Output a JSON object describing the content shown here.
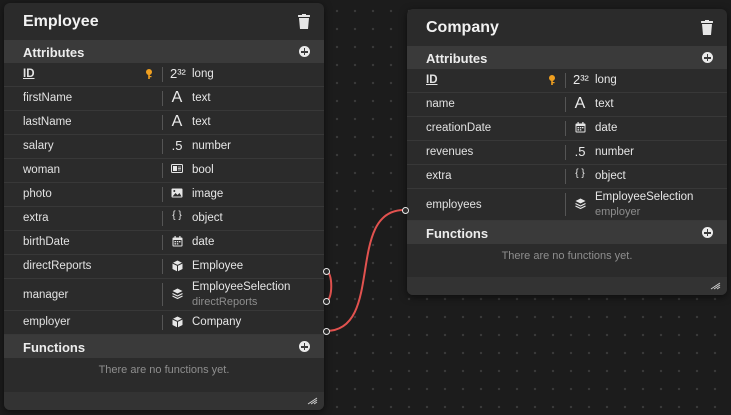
{
  "employee": {
    "title": "Employee",
    "attributes_label": "Attributes",
    "functions_label": "Functions",
    "empty_functions": "There are no functions yet.",
    "attributes": [
      {
        "name": "ID",
        "type_icon": "2³²",
        "type": "long",
        "pk": true
      },
      {
        "name": "firstName",
        "type_icon": "A",
        "type": "text"
      },
      {
        "name": "lastName",
        "type_icon": "A",
        "type": "text"
      },
      {
        "name": "salary",
        "type_icon": ".5",
        "type": "number"
      },
      {
        "name": "woman",
        "type_icon": "bool-icon",
        "type": "bool"
      },
      {
        "name": "photo",
        "type_icon": "image-icon",
        "type": "image"
      },
      {
        "name": "extra",
        "type_icon": "{ }",
        "type": "object"
      },
      {
        "name": "birthDate",
        "type_icon": "calendar-icon",
        "type": "date"
      },
      {
        "name": "directReports",
        "type_icon": "cube-icon",
        "type": "Employee"
      },
      {
        "name": "manager",
        "type_icon": "layers-icon",
        "type": "EmployeeSelection",
        "sub": "directReports"
      },
      {
        "name": "employer",
        "type_icon": "cube-icon",
        "type": "Company"
      }
    ]
  },
  "company": {
    "title": "Company",
    "attributes_label": "Attributes",
    "functions_label": "Functions",
    "empty_functions": "There are no functions yet.",
    "attributes": [
      {
        "name": "ID",
        "type_icon": "2³²",
        "type": "long",
        "pk": true
      },
      {
        "name": "name",
        "type_icon": "A",
        "type": "text"
      },
      {
        "name": "creationDate",
        "type_icon": "calendar-icon",
        "type": "date"
      },
      {
        "name": "revenues",
        "type_icon": ".5",
        "type": "number"
      },
      {
        "name": "extra",
        "type_icon": "{ }",
        "type": "object"
      },
      {
        "name": "employees",
        "type_icon": "layers-icon",
        "type": "EmployeeSelection",
        "sub": "employer"
      }
    ]
  },
  "colors": {
    "link": "#e2524f",
    "key": "#f0a020",
    "background": "#1c1c1c",
    "card": "#2b2b2b"
  }
}
